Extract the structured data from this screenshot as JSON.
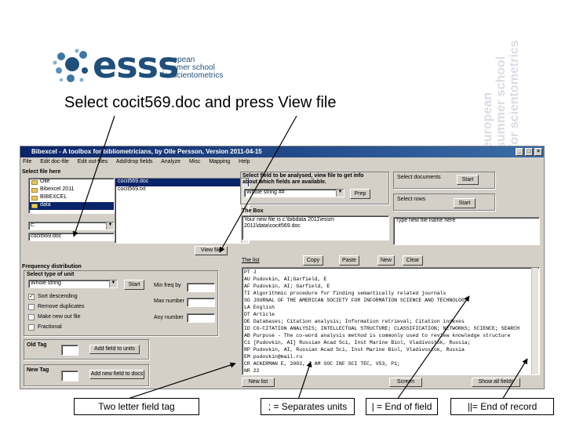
{
  "slide": {
    "caption_top": "Select cocit569.doc and press View file",
    "captions_bottom": [
      "Two letter field tag",
      "; = Separates units",
      "| = End of field",
      "||= End of record"
    ]
  },
  "logo": {
    "word": "esss",
    "subtitle_lines": [
      "european",
      "summer school",
      "for scientometrics"
    ]
  },
  "watermark": {
    "lines": [
      "european",
      "summer school",
      "for scientometrics"
    ]
  },
  "window": {
    "title": "Bibexcel - A toolbox for bibliometricians, by Olle Persson, Version 2011-04-15",
    "menu": [
      "File",
      "Edit doc-file",
      "Edit out-files",
      "Add/drop fields",
      "Analyze",
      "Misc",
      "Mapping",
      "Help"
    ],
    "select_file_label": "Select file here",
    "folders": [
      "Olle",
      "Bibexcel 2011",
      "BIBEXCEL",
      "data"
    ],
    "files": [
      "cocit569.doc",
      "cocit569.txt"
    ],
    "drive": "c:",
    "file_field": "cocit569.doc",
    "view_file_button": "View file",
    "select_field_label": "Select field to be analysed, view file to get info about which fields are available.",
    "field_dropdown": "Whole string  ##",
    "prep_button": "Prep",
    "the_box_label": "The Box",
    "the_box_text": [
      "Your new file is c:\\bibdata 2011\\essm",
      "2011\\data\\cocit569.doc"
    ],
    "select_documents_label": "Select documents",
    "start_docs_button": "Start",
    "select_rows_label": "Select rows",
    "start_rows_button": "Start",
    "type_new_file_label": "Type new file name here",
    "list_label": "The list",
    "copy_button": "Copy",
    "paste_button": "Paste",
    "new_button": "New",
    "clear_button": "Clear",
    "freq_label": "Frequency distribution",
    "select_unit_label": "Select type of unit",
    "unit_dropdown": "Whole string",
    "freq_start_button": "Start",
    "min_freq_label": "Min freq by",
    "max_number_label": "Max number",
    "any_number_label": "Any number",
    "options": [
      "Sort descending",
      "Remove duplicates",
      "Make new out file",
      "Fractional"
    ],
    "option_checked": [
      true,
      false,
      false,
      false
    ],
    "old_tag_label": "Old Tag",
    "add_field_button": "Add field to units",
    "new_tag_label": "New Tag",
    "add_new_field_button": "Add new field to docs",
    "record_lines": [
      "PT J",
      "AU Pudovkin, AI;Garfield, E",
      "AF Pudovkin, AI; Garfield, E",
      "TI Algorithmic procedure for finding semantically related journals",
      "SO JOURNAL OF THE AMERICAN SOCIETY FOR INFORMATION SCIENCE AND TECHNOLOGY",
      "LA English",
      "DT Article",
      "DE Databases; Citation analysis; Information retrieval; Citation indexes",
      "ID CO-CITATION ANALYSIS; INTELLECTUAL STRUCTURE; CLASSIFICATION; NETWORKS; SCIENCE; SEARCH",
      "AB Purpose - The co-word analysis method is commonly used to review knowledge structure",
      "C1 [Pudovkin, AI] Russian Acad Sci, Inst Marine Biol, Vladivostok, Russia;",
      "RP Pudovkin, AI, Russian Acad Sci, Inst Marine Biol, Vladivostok, Russia",
      "EM pudovkin@mail.ru",
      "CR ACKERMAN E, 2002, J AM SOC INF SCI TEC, V53, P1;",
      "NR 22"
    ],
    "new_list_button": "New list",
    "screen_button": "Screen",
    "show_all_button": "Show all fields"
  },
  "colors": {
    "logo_blue": "#1f4f7a",
    "window_bg": "#d4d0c8",
    "titlebar": "#0a246a"
  }
}
